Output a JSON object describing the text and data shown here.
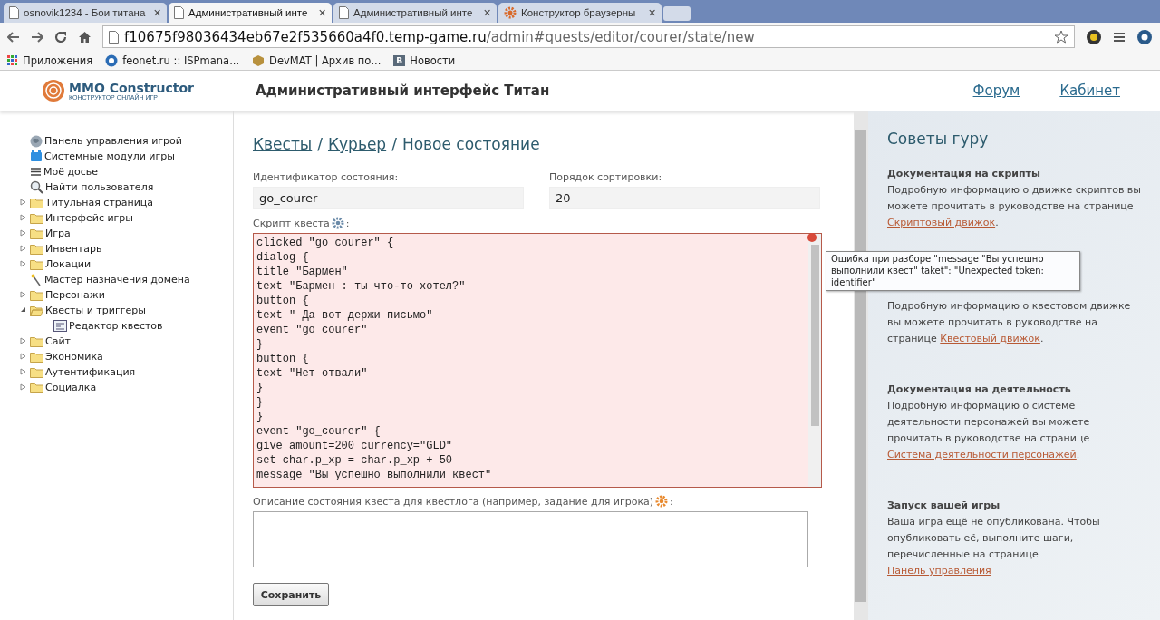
{
  "browser": {
    "tabs": [
      {
        "label": "osnovik1234 - Бои титана",
        "kind": "page",
        "close": "✕",
        "selected": false
      },
      {
        "label": "Административный инте",
        "kind": "page",
        "close": "✕",
        "selected": true
      },
      {
        "label": "Административный инте",
        "kind": "page",
        "close": "✕",
        "selected": false
      },
      {
        "label": "Конструктор браузерны",
        "kind": "gear",
        "close": "✕",
        "selected": false
      }
    ],
    "url_host": "f10675f98036434eb67e2f535660a4f0.temp-game.ru",
    "url_path": "/admin#quests/editor/courer/state/new",
    "bookmarks": [
      {
        "label": "Приложения",
        "kind": "apps"
      },
      {
        "label": "feonet.ru :: ISPmana...",
        "kind": "globe"
      },
      {
        "label": "DevMAT | Архив по...",
        "kind": "box"
      },
      {
        "label": "Новости",
        "kind": "letter",
        "badge": "B"
      }
    ]
  },
  "header": {
    "logo": "MMO Constructor",
    "logo_sub": "КОНСТРУКТОР ОНЛАЙН ИГР",
    "title": "Административный интерфейс Титан",
    "links": [
      "Форум",
      "Кабинет"
    ]
  },
  "sidebar": {
    "items": [
      {
        "label": "Панель управления игрой",
        "kind": "globe"
      },
      {
        "label": "Системные модули игры",
        "kind": "modules"
      },
      {
        "label": "Моё досье",
        "kind": "list"
      },
      {
        "label": "Найти пользователя",
        "kind": "search"
      },
      {
        "label": "Титульная страница",
        "kind": "folder",
        "expanded": false
      },
      {
        "label": "Интерфейс игры",
        "kind": "folder",
        "expanded": false
      },
      {
        "label": "Игра",
        "kind": "folder",
        "expanded": false
      },
      {
        "label": "Инвентарь",
        "kind": "folder",
        "expanded": false
      },
      {
        "label": "Локации",
        "kind": "folder",
        "expanded": false
      },
      {
        "label": "Мастер назначения домена",
        "kind": "wand"
      },
      {
        "label": "Персонажи",
        "kind": "folder",
        "expanded": false
      },
      {
        "label": "Квесты и триггеры",
        "kind": "folder",
        "expanded": true,
        "children": [
          {
            "label": "Редактор квестов",
            "kind": "editor"
          }
        ]
      },
      {
        "label": "Сайт",
        "kind": "folder",
        "expanded": false
      },
      {
        "label": "Экономика",
        "kind": "folder",
        "expanded": false
      },
      {
        "label": "Аутентификация",
        "kind": "folder",
        "expanded": false
      },
      {
        "label": "Социалка",
        "kind": "folder",
        "expanded": false
      }
    ]
  },
  "breadcrumbs": [
    {
      "label": "Квесты",
      "kind": "link"
    },
    {
      "label": "/",
      "kind": "separator"
    },
    {
      "label": "Курьер",
      "kind": "link"
    },
    {
      "label": "/",
      "kind": "separator"
    },
    {
      "label": "Новое состояние",
      "kind": "current"
    }
  ],
  "form": {
    "id_label": "Идентификатор состояния:",
    "id_value": "go_courer",
    "sort_label": "Порядок сортировки:",
    "sort_value": "20",
    "script_label": "Скрипт квеста",
    "script_label_end": ":",
    "script_error": true,
    "script_lines": [
      "clicked \"go_courer\" {",
      "dialog {",
      "title \"Бармен\"",
      "text \"Бармен : ты что-то хотел?\"",
      "button {",
      "text \" Да вот держи письмо\"",
      "event \"go_courer\"",
      "}",
      "button {",
      "text \"Нет отвали\"",
      "}",
      "}",
      "}",
      "event \"go_courer\" {",
      "give amount=200 currency=\"GLD\"",
      "set char.p_xp = char.p_xp + 50",
      "message \"Вы успешно выполнили квест\""
    ],
    "description_label": "Описание состояния квеста для квестлога (например, задание для игрока)",
    "description_label_end": ":",
    "save_button": "Сохранить"
  },
  "tooltip": "Ошибка при разборе \"message \"Вы успешно выполнили квест\" taket\": \"Unexpected token: identifier\"",
  "tips": {
    "title": "Советы гуру",
    "sections": [
      {
        "heading": "Документация на скрипты",
        "text": "Подробную информацию о движке скриптов вы можете прочитать в руководстве на странице ",
        "link": "Скриптовый движок",
        "after": "."
      },
      {
        "text": "Подробную информацию о квестовом движке вы можете прочитать в руководстве на странице ",
        "link": "Квестовый движок",
        "after": "."
      },
      {
        "heading": "Документация на деятельность",
        "text": "Подробную информацию о системе деятельности персонажей вы можете прочитать в руководстве на странице ",
        "link": "Система деятельности персонажей",
        "after": "."
      },
      {
        "heading": "Запуск вашей игры",
        "text": "Ваша игра ещё не опубликована. Чтобы опубликовать её, выполните шаги, перечисленные на странице ",
        "link": "Панель управления"
      }
    ]
  }
}
